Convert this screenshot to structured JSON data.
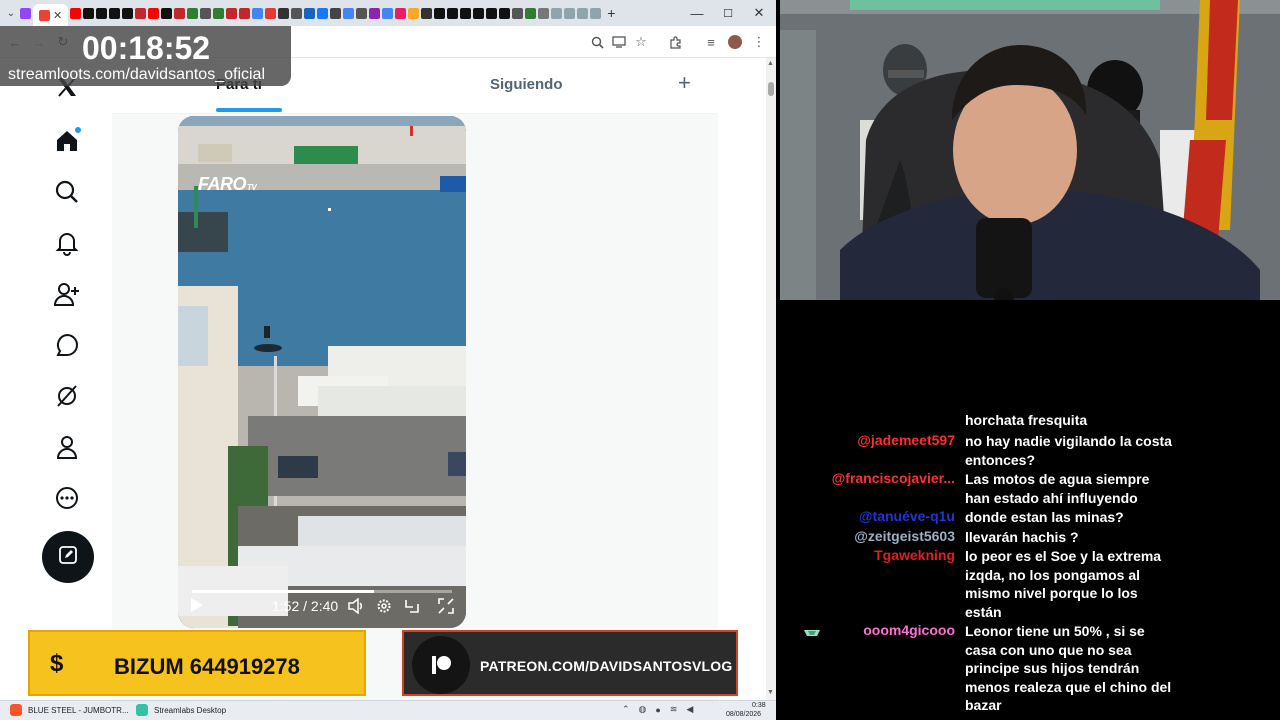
{
  "timer": {
    "elapsed": "00:18:52",
    "channel_url": "streamloots.com/davidsantos_oficial"
  },
  "browser": {
    "window_controls": [
      "—",
      "☐",
      "✕"
    ],
    "new_tab": "+"
  },
  "x_app": {
    "feed_tabs": {
      "for_you": "Para ti",
      "following": "Siguiendo",
      "add": "+"
    },
    "nav_items": [
      "x-logo-icon",
      "home-icon",
      "search-icon",
      "notifications-icon",
      "follow-icon",
      "chat-icon",
      "grok-icon",
      "profile-icon",
      "more-icon"
    ],
    "compose_icon": "compose-icon",
    "video": {
      "watermark": "FARO",
      "watermark_sub": "TV",
      "time": "1:52 / 2:40",
      "progress": 0.7
    }
  },
  "banners": {
    "bizum_symbol": "$",
    "bizum": "BIZUM 644919278",
    "patreon": "PATREON.COM/DAVIDSANTOSVLOG"
  },
  "taskbar": {
    "apps": [
      "BLUE STEEL - JUMBOTR...",
      "Streamlabs Desktop"
    ],
    "time": "0:38",
    "date": "08/08/2026"
  },
  "chat": {
    "partial_line": "horchata fresquita",
    "messages": [
      {
        "user": "@jademeet597",
        "color": "#ff2d2d",
        "lines": [
          "no hay nadie vigilando la costa",
          "entonces?"
        ]
      },
      {
        "user": "@franciscojavier...",
        "color": "#ff3030",
        "lines": [
          "Las motos de agua siempre",
          "han estado ahí influyendo"
        ]
      },
      {
        "user": "@tanuéve-q1u",
        "color": "#2433d6",
        "lines": [
          "donde estan las minas?"
        ]
      },
      {
        "user": "@zeitgeist5603",
        "color": "#9ab0c4",
        "lines": [
          "llevarán hachis ?"
        ]
      },
      {
        "user": "Tgawekning",
        "color": "#e02020",
        "lines": [
          "lo peor es el Soe y la extrema",
          "izqda, no los pongamos al",
          "mismo nivel porque lo los",
          "están"
        ]
      },
      {
        "user": "ooom4gicooo",
        "color": "#ff6fd0",
        "lines": [
          "Leonor tiene un 50% , si se",
          "casa con uno que no sea",
          "principe sus hijos tendrán",
          "menos realeza que el chino del",
          "bazar"
        ]
      }
    ]
  },
  "colors": {
    "x_blue": "#1d9bf0",
    "bizum_yellow": "#f6c21d",
    "patreon_orange": "#d0451f"
  }
}
